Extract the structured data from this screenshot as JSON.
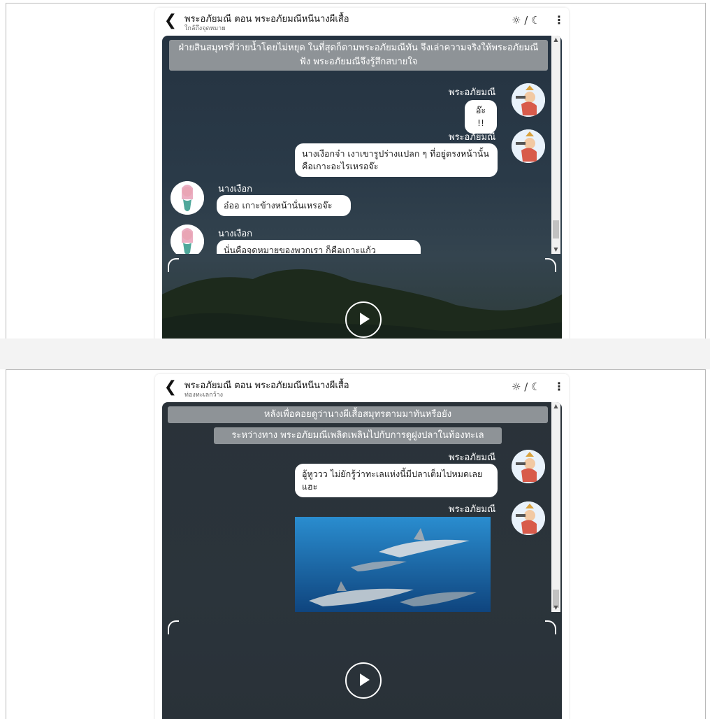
{
  "screens": [
    {
      "header": {
        "title": "พระอภัยมณี ตอน พระอภัยมณีหนีนางผีเสื้อ",
        "subtitle": "ใกล้ถึงจุดหมาย",
        "theme_toggle": "☼ / ☾",
        "menu": "⋮"
      },
      "narrations": [
        "ฝ่ายสินสมุทรที่ว่ายน้ำโดยไม่หยุด ในที่สุดก็ตามพระอภัยมณีทัน จึงเล่าความจริงให้พระอภัยมณีฟัง พระอภัยมณีจึงรู้สึกสบายใจ"
      ],
      "messages": [
        {
          "speaker": "พระอภัยมณี",
          "text": "อ๊ะ !!"
        },
        {
          "speaker": "พระอภัยมณี",
          "text": "นางเงือกจ๋า เงาเขารูปร่างแปลก ๆ ที่อยู่ตรงหน้านั้น คือเกาะอะไรเหรอจ๊ะ"
        },
        {
          "speaker": "นางเงือก",
          "text": "อ๋ออ เกาะข้างหน้านั่นเหรอจ๊ะ"
        },
        {
          "speaker": "นางเงือก",
          "text": "นั่นคือจุดหมายของพวกเรา ก็คือเกาะแก้ว"
        }
      ]
    },
    {
      "header": {
        "title": "พระอภัยมณี ตอน พระอภัยมณีหนีนางผีเสื้อ",
        "subtitle": "ท่องทะเลกว้าง",
        "theme_toggle": "☼ / ☾",
        "menu": "⋮"
      },
      "narrations": [
        "หลังเพื่อคอยดูว่านางผีเสื้อสมุทรตามมาทันหรือยัง",
        "ระหว่างทาง พระอภัยมณีเพลิดเพลินไปกับการดูฝูงปลาในท้องทะเล"
      ],
      "messages": [
        {
          "speaker": "พระอภัยมณี",
          "text": "อู้หูววว ไม่ยักรู้ว่าทะเลแห่งนี้มีปลาเต็มไปหมดเลยแฮะ"
        },
        {
          "speaker": "พระอภัยมณี",
          "text": ""
        }
      ]
    }
  ],
  "icons": {
    "back": "chevron-left-icon",
    "theme": "sun-moon-icon",
    "menu": "kebab-menu-icon",
    "play": "play-icon"
  },
  "colors": {
    "stage": "#263440",
    "narration": "#8e9397",
    "bubble": "#ffffff",
    "accent_water": "#1e6fa8"
  }
}
